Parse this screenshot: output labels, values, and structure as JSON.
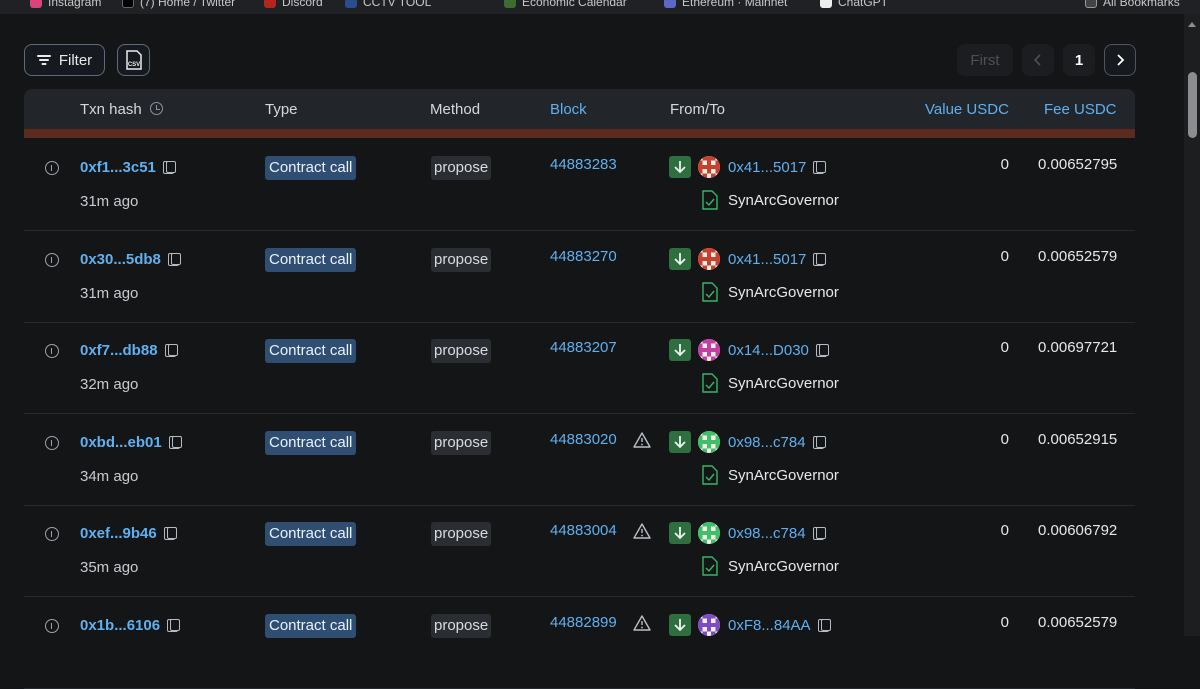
{
  "bookmarks": [
    "Instagram",
    "(7) Home / Twitter",
    "Discord",
    "CCTV TOOL",
    "Economic Calendar",
    "Ethereum · Mainnet",
    "ChatGPT",
    "All Bookmarks"
  ],
  "toolbar": {
    "filter_label": "Filter",
    "csv_label": "CSV"
  },
  "pager": {
    "first": "First",
    "page": "1"
  },
  "columns": {
    "txn_hash": "Txn hash",
    "type": "Type",
    "method": "Method",
    "block": "Block",
    "from_to": "From/To",
    "value": "Value USDC",
    "fee": "Fee USDC"
  },
  "rows": [
    {
      "hash": "0xf1...3c51",
      "age": "31m ago",
      "type": "Contract call",
      "method": "propose",
      "block": "44883283",
      "warn": false,
      "from": "0x41...5017",
      "to": "SynArcGovernor",
      "value": "0",
      "fee": "0.00652795",
      "avatar_color": "#c8412f"
    },
    {
      "hash": "0x30...5db8",
      "age": "31m ago",
      "type": "Contract call",
      "method": "propose",
      "block": "44883270",
      "warn": false,
      "from": "0x41...5017",
      "to": "SynArcGovernor",
      "value": "0",
      "fee": "0.00652579",
      "avatar_color": "#c8412f"
    },
    {
      "hash": "0xf7...db88",
      "age": "32m ago",
      "type": "Contract call",
      "method": "propose",
      "block": "44883207",
      "warn": false,
      "from": "0x14...D030",
      "to": "SynArcGovernor",
      "value": "0",
      "fee": "0.00697721",
      "avatar_color": "#c43ea8"
    },
    {
      "hash": "0xbd...eb01",
      "age": "34m ago",
      "type": "Contract call",
      "method": "propose",
      "block": "44883020",
      "warn": true,
      "from": "0x98...c784",
      "to": "SynArcGovernor",
      "value": "0",
      "fee": "0.00652915",
      "avatar_color": "#3fbf6a"
    },
    {
      "hash": "0xef...9b46",
      "age": "35m ago",
      "type": "Contract call",
      "method": "propose",
      "block": "44883004",
      "warn": true,
      "from": "0x98...c784",
      "to": "SynArcGovernor",
      "value": "0",
      "fee": "0.00606792",
      "avatar_color": "#3fbf6a"
    },
    {
      "hash": "0x1b...6106",
      "age": "",
      "type": "Contract call",
      "method": "propose",
      "block": "44882899",
      "warn": true,
      "from": "0xF8...84AA",
      "to": "",
      "value": "0",
      "fee": "0.00652579",
      "avatar_color": "#7d4cc4"
    }
  ]
}
